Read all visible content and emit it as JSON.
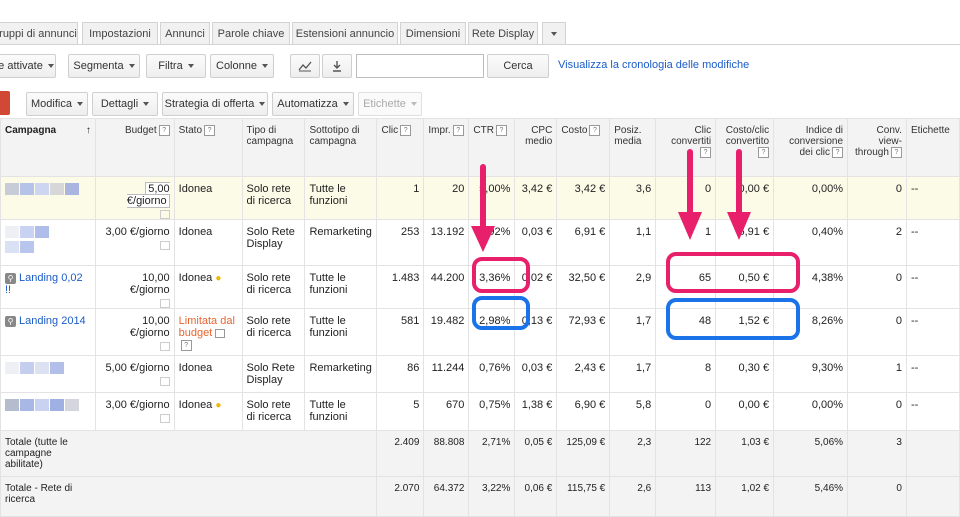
{
  "tabs": [
    "ruppi di annunci",
    "Impostazioni",
    "Annunci",
    "Parole chiave",
    "Estensioni annuncio",
    "Dimensioni",
    "Rete Display"
  ],
  "toolbar1": {
    "status_filter": "e attivate",
    "segmenta": "Segmenta",
    "filtra": "Filtra",
    "colonne": "Colonne",
    "search_button": "Cerca",
    "search_value": "",
    "history_link": "Visualizza la cronologia delle modifiche"
  },
  "toolbar2": {
    "modifica": "Modifica",
    "dettagli": "Dettagli",
    "strategia": "Strategia di offerta",
    "automatizza": "Automatizza",
    "etichette": "Etichette"
  },
  "colors": {
    "highlight_pink": "#e81f6a",
    "highlight_blue": "#1a73e8",
    "link": "#1a5cc9",
    "limited": "#e8642f"
  },
  "table": {
    "headers": {
      "campagna": "Campagna",
      "budget": "Budget",
      "stato": "Stato",
      "tipo": "Tipo di campagna",
      "sottotipo": "Sottotipo di campagna",
      "clic": "Clic",
      "impr": "Impr.",
      "ctr": "CTR",
      "cpc": "CPC medio",
      "costo": "Costo",
      "posiz": "Posiz. media",
      "clic_conv": "Clic convertiti",
      "costo_clic_conv": "Costo/clic convertito",
      "indice": "Indice di conversione dei clic",
      "conv_view": "Conv. view-through",
      "etichette": "Etichette"
    },
    "rows": [
      {
        "campaign": "",
        "budget": "5,00 €/giorno",
        "stato": "Idonea",
        "tipo": "Solo rete di ricerca",
        "sottotipo": "Tutte le funzioni",
        "clic": "1",
        "impr": "20",
        "ctr": "5,00%",
        "cpc": "3,42 €",
        "costo": "3,42 €",
        "posiz": "3,6",
        "clic_conv": "0",
        "costo_conv": "0,00 €",
        "indice": "0,00%",
        "view": "0",
        "etichette": "--"
      },
      {
        "campaign": "",
        "budget": "3,00 €/giorno",
        "stato": "Idonea",
        "tipo": "Solo Rete Display",
        "sottotipo": "Remarketing",
        "clic": "253",
        "impr": "13.192",
        "ctr": "1,92%",
        "cpc": "0,03 €",
        "costo": "6,91 €",
        "posiz": "1,1",
        "clic_conv": "1",
        "costo_conv": "6,91 €",
        "indice": "0,40%",
        "view": "2",
        "etichette": "--"
      },
      {
        "campaign": "Landing 0,02 !!",
        "budget": "10,00 €/giorno",
        "stato": "Idonea",
        "tipo": "Solo rete di ricerca",
        "sottotipo": "Tutte le funzioni",
        "clic": "1.483",
        "impr": "44.200",
        "ctr": "3,36%",
        "cpc": "0,02 €",
        "costo": "32,50 €",
        "posiz": "2,9",
        "clic_conv": "65",
        "costo_conv": "0,50 €",
        "indice": "4,38%",
        "view": "0",
        "etichette": "--"
      },
      {
        "campaign": "Landing 2014",
        "budget": "10,00 €/giorno",
        "stato": "Limitata dal budget",
        "tipo": "Solo rete di ricerca",
        "sottotipo": "Tutte le funzioni",
        "clic": "581",
        "impr": "19.482",
        "ctr": "2,98%",
        "cpc": "0,13 €",
        "costo": "72,93 €",
        "posiz": "1,7",
        "clic_conv": "48",
        "costo_conv": "1,52 €",
        "indice": "8,26%",
        "view": "0",
        "etichette": "--"
      },
      {
        "campaign": "",
        "budget": "5,00 €/giorno",
        "stato": "Idonea",
        "tipo": "Solo Rete Display",
        "sottotipo": "Remarketing",
        "clic": "86",
        "impr": "11.244",
        "ctr": "0,76%",
        "cpc": "0,03 €",
        "costo": "2,43 €",
        "posiz": "1,7",
        "clic_conv": "8",
        "costo_conv": "0,30 €",
        "indice": "9,30%",
        "view": "1",
        "etichette": "--"
      },
      {
        "campaign": "",
        "budget": "3,00 €/giorno",
        "stato": "Idonea",
        "tipo": "Solo rete di ricerca",
        "sottotipo": "Tutte le funzioni",
        "clic": "5",
        "impr": "670",
        "ctr": "0,75%",
        "cpc": "1,38 €",
        "costo": "6,90 €",
        "posiz": "5,8",
        "clic_conv": "0",
        "costo_conv": "0,00 €",
        "indice": "0,00%",
        "view": "0",
        "etichette": "--"
      }
    ],
    "totals": [
      {
        "label": "Totale (tutte le campagne abilitate)",
        "clic": "2.409",
        "impr": "88.808",
        "ctr": "2,71%",
        "cpc": "0,05 €",
        "costo": "125,09 €",
        "posiz": "2,3",
        "clic_conv": "122",
        "costo_conv": "1,03 €",
        "indice": "5,06%",
        "view": "3"
      },
      {
        "label": "Totale - Rete di ricerca",
        "clic": "2.070",
        "impr": "64.372",
        "ctr": "3,22%",
        "cpc": "0,06 €",
        "costo": "115,75 €",
        "posiz": "2,6",
        "clic_conv": "113",
        "costo_conv": "1,02 €",
        "indice": "5,46%",
        "view": "0"
      }
    ]
  }
}
